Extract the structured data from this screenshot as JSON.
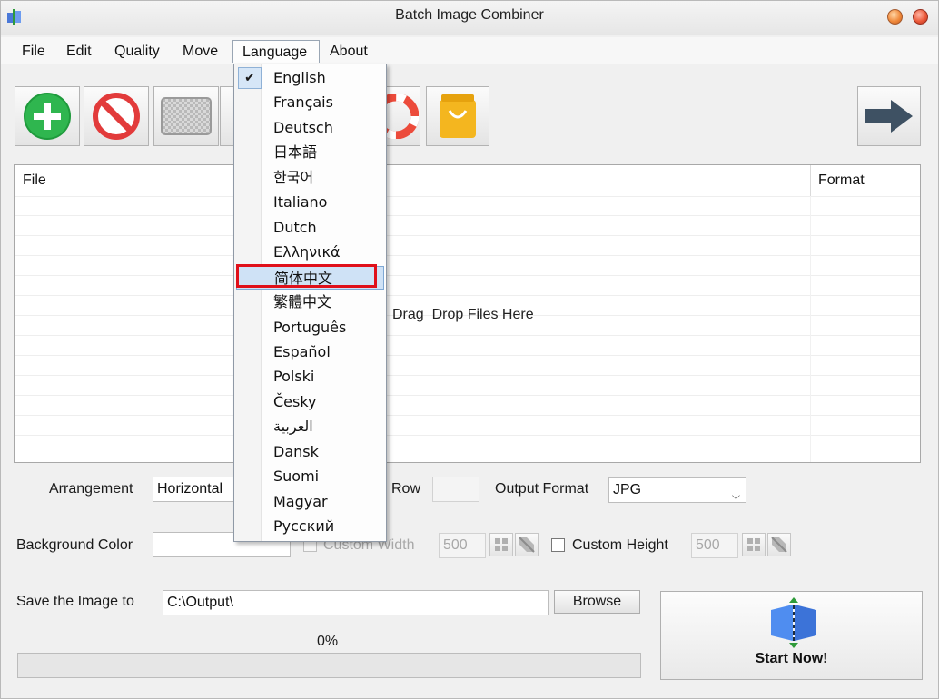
{
  "window": {
    "title": "Batch Image Combiner"
  },
  "menubar": {
    "items": [
      "File",
      "Edit",
      "Quality",
      "Move",
      "Language",
      "About"
    ]
  },
  "toolbar": {
    "buttons": [
      "add-icon",
      "remove-icon",
      "clear-icon",
      "help-icon",
      "shop-icon",
      "next-arrow-icon"
    ]
  },
  "filelist": {
    "columns": [
      "File",
      "Format"
    ],
    "drop_hint": "Drag  Drop Files Here"
  },
  "language_menu": {
    "selected": "English",
    "hovered": "简体中文",
    "items": [
      "English",
      "Français",
      "Deutsch",
      "日本語",
      "한국어",
      "Italiano",
      "Dutch",
      "Ελληνικά",
      "简体中文",
      "繁體中文",
      "Português",
      "Español",
      "Polski",
      "Česky",
      "العربية",
      "Dansk",
      "Suomi",
      "Magyar",
      "Русский"
    ]
  },
  "options": {
    "arrangement_label": "Arrangement",
    "arrangement_value": "Horizontal",
    "row_label": "Row",
    "row_value": "",
    "output_format_label": "Output Format",
    "output_format_value": "JPG",
    "background_color_label": "Background Color",
    "custom_width_label": "Custom Width",
    "custom_width_value": "500",
    "custom_height_label": "Custom Height",
    "custom_height_value": "500",
    "save_to_label": "Save the Image to",
    "save_to_value": "C:\\Output\\",
    "browse_label": "Browse"
  },
  "progress": {
    "percent_text": "0%",
    "value": 0
  },
  "start": {
    "label": "Start Now!"
  },
  "colors": {
    "highlight_border": "#e0101a",
    "menu_hover": "#cfe2f6",
    "add_green": "#2fb64f",
    "remove_red": "#e23b3b",
    "shop_yellow": "#f4b61f",
    "arrow_dark": "#3e5163"
  }
}
